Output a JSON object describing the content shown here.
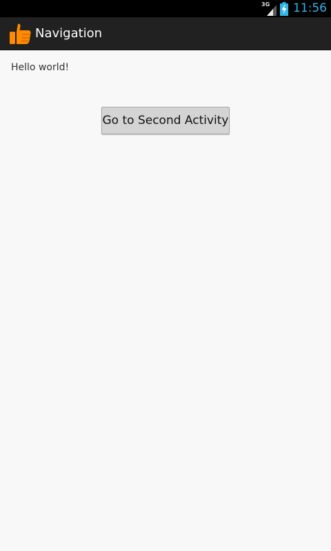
{
  "status_bar": {
    "network_label": "3G",
    "clock": "11:56",
    "colors": {
      "clock": "#33b5e5",
      "background": "#000000"
    }
  },
  "action_bar": {
    "title": "Navigation",
    "icon": "thumbs-up-icon",
    "colors": {
      "background": "#212121",
      "icon": "#ff8a00"
    }
  },
  "main": {
    "hello_text": "Hello world!",
    "button_label": "Go to Second Activity"
  }
}
